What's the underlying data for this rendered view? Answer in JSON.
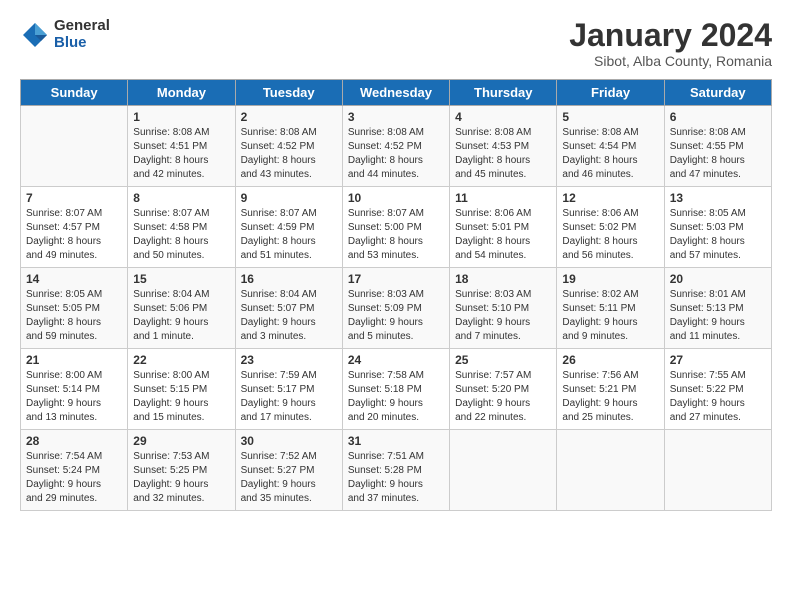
{
  "logo": {
    "general": "General",
    "blue": "Blue"
  },
  "title": "January 2024",
  "subtitle": "Sibot, Alba County, Romania",
  "weekdays": [
    "Sunday",
    "Monday",
    "Tuesday",
    "Wednesday",
    "Thursday",
    "Friday",
    "Saturday"
  ],
  "weeks": [
    [
      {
        "day": "",
        "info": ""
      },
      {
        "day": "1",
        "info": "Sunrise: 8:08 AM\nSunset: 4:51 PM\nDaylight: 8 hours\nand 42 minutes."
      },
      {
        "day": "2",
        "info": "Sunrise: 8:08 AM\nSunset: 4:52 PM\nDaylight: 8 hours\nand 43 minutes."
      },
      {
        "day": "3",
        "info": "Sunrise: 8:08 AM\nSunset: 4:52 PM\nDaylight: 8 hours\nand 44 minutes."
      },
      {
        "day": "4",
        "info": "Sunrise: 8:08 AM\nSunset: 4:53 PM\nDaylight: 8 hours\nand 45 minutes."
      },
      {
        "day": "5",
        "info": "Sunrise: 8:08 AM\nSunset: 4:54 PM\nDaylight: 8 hours\nand 46 minutes."
      },
      {
        "day": "6",
        "info": "Sunrise: 8:08 AM\nSunset: 4:55 PM\nDaylight: 8 hours\nand 47 minutes."
      }
    ],
    [
      {
        "day": "7",
        "info": "Sunrise: 8:07 AM\nSunset: 4:57 PM\nDaylight: 8 hours\nand 49 minutes."
      },
      {
        "day": "8",
        "info": "Sunrise: 8:07 AM\nSunset: 4:58 PM\nDaylight: 8 hours\nand 50 minutes."
      },
      {
        "day": "9",
        "info": "Sunrise: 8:07 AM\nSunset: 4:59 PM\nDaylight: 8 hours\nand 51 minutes."
      },
      {
        "day": "10",
        "info": "Sunrise: 8:07 AM\nSunset: 5:00 PM\nDaylight: 8 hours\nand 53 minutes."
      },
      {
        "day": "11",
        "info": "Sunrise: 8:06 AM\nSunset: 5:01 PM\nDaylight: 8 hours\nand 54 minutes."
      },
      {
        "day": "12",
        "info": "Sunrise: 8:06 AM\nSunset: 5:02 PM\nDaylight: 8 hours\nand 56 minutes."
      },
      {
        "day": "13",
        "info": "Sunrise: 8:05 AM\nSunset: 5:03 PM\nDaylight: 8 hours\nand 57 minutes."
      }
    ],
    [
      {
        "day": "14",
        "info": "Sunrise: 8:05 AM\nSunset: 5:05 PM\nDaylight: 8 hours\nand 59 minutes."
      },
      {
        "day": "15",
        "info": "Sunrise: 8:04 AM\nSunset: 5:06 PM\nDaylight: 9 hours\nand 1 minute."
      },
      {
        "day": "16",
        "info": "Sunrise: 8:04 AM\nSunset: 5:07 PM\nDaylight: 9 hours\nand 3 minutes."
      },
      {
        "day": "17",
        "info": "Sunrise: 8:03 AM\nSunset: 5:09 PM\nDaylight: 9 hours\nand 5 minutes."
      },
      {
        "day": "18",
        "info": "Sunrise: 8:03 AM\nSunset: 5:10 PM\nDaylight: 9 hours\nand 7 minutes."
      },
      {
        "day": "19",
        "info": "Sunrise: 8:02 AM\nSunset: 5:11 PM\nDaylight: 9 hours\nand 9 minutes."
      },
      {
        "day": "20",
        "info": "Sunrise: 8:01 AM\nSunset: 5:13 PM\nDaylight: 9 hours\nand 11 minutes."
      }
    ],
    [
      {
        "day": "21",
        "info": "Sunrise: 8:00 AM\nSunset: 5:14 PM\nDaylight: 9 hours\nand 13 minutes."
      },
      {
        "day": "22",
        "info": "Sunrise: 8:00 AM\nSunset: 5:15 PM\nDaylight: 9 hours\nand 15 minutes."
      },
      {
        "day": "23",
        "info": "Sunrise: 7:59 AM\nSunset: 5:17 PM\nDaylight: 9 hours\nand 17 minutes."
      },
      {
        "day": "24",
        "info": "Sunrise: 7:58 AM\nSunset: 5:18 PM\nDaylight: 9 hours\nand 20 minutes."
      },
      {
        "day": "25",
        "info": "Sunrise: 7:57 AM\nSunset: 5:20 PM\nDaylight: 9 hours\nand 22 minutes."
      },
      {
        "day": "26",
        "info": "Sunrise: 7:56 AM\nSunset: 5:21 PM\nDaylight: 9 hours\nand 25 minutes."
      },
      {
        "day": "27",
        "info": "Sunrise: 7:55 AM\nSunset: 5:22 PM\nDaylight: 9 hours\nand 27 minutes."
      }
    ],
    [
      {
        "day": "28",
        "info": "Sunrise: 7:54 AM\nSunset: 5:24 PM\nDaylight: 9 hours\nand 29 minutes."
      },
      {
        "day": "29",
        "info": "Sunrise: 7:53 AM\nSunset: 5:25 PM\nDaylight: 9 hours\nand 32 minutes."
      },
      {
        "day": "30",
        "info": "Sunrise: 7:52 AM\nSunset: 5:27 PM\nDaylight: 9 hours\nand 35 minutes."
      },
      {
        "day": "31",
        "info": "Sunrise: 7:51 AM\nSunset: 5:28 PM\nDaylight: 9 hours\nand 37 minutes."
      },
      {
        "day": "",
        "info": ""
      },
      {
        "day": "",
        "info": ""
      },
      {
        "day": "",
        "info": ""
      }
    ]
  ]
}
